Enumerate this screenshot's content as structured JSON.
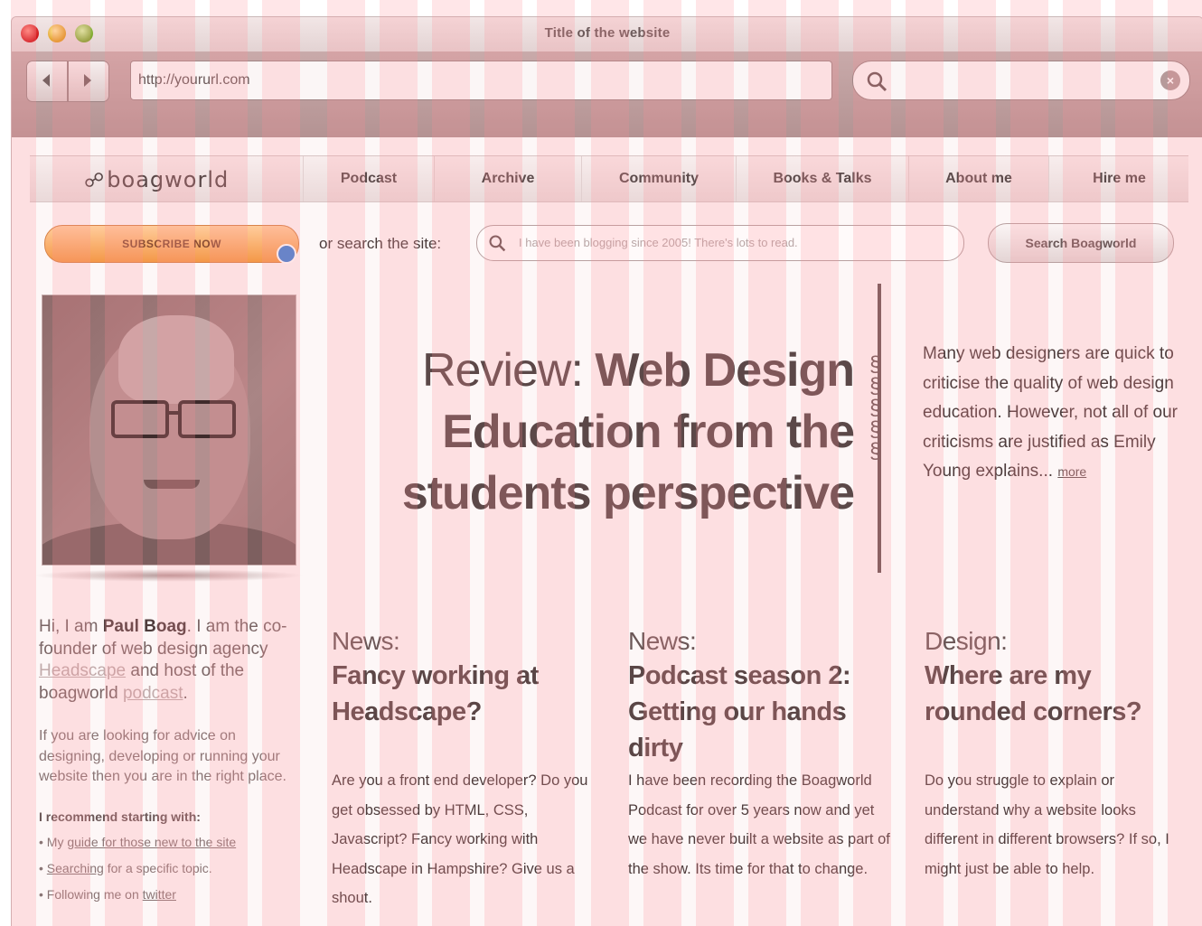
{
  "window": {
    "title": "Title of the website"
  },
  "toolbar": {
    "url": "http://yoururl.com"
  },
  "site": {
    "logo": "boagworld",
    "nav": [
      {
        "label": "Podcast"
      },
      {
        "label": "Archive"
      },
      {
        "label": "Community"
      },
      {
        "label": "Books & Talks"
      },
      {
        "label": "About me"
      },
      {
        "label": "Hire me"
      }
    ],
    "subscribe_label": "SUBSCRIBE NOW",
    "search_label": "or search the site:",
    "search_placeholder": "I have been blogging since 2005! There's lots to read.",
    "search_button": "Search Boagworld",
    "hero": {
      "light": "Review: ",
      "strong": "Web Design Education from the students perspective"
    },
    "intro": {
      "text": "Many web designers are quick to criticise the quality of web design education. However, not all of our criticisms are justified as Emily Young explains...",
      "more": "more"
    },
    "bio": {
      "p1_a": "Hi, I am ",
      "name": "Paul Boag",
      "p1_b": ". I am the co-founder of web design agency ",
      "agency_link": "Headscape",
      "p1_c": " and host of the boagworld ",
      "podcast_link": "podcast",
      "p1_d": ".",
      "p2": "If you are looking for advice on designing, developing or running your website then you are in the right place.",
      "recommend": "I recommend starting with:",
      "bullets": [
        {
          "pre": "My ",
          "link": "guide for those new to the site",
          "post": ""
        },
        {
          "pre": "",
          "link": "Searching",
          "post": " for a specific topic."
        },
        {
          "pre": "Following me on ",
          "link": "twitter",
          "post": ""
        }
      ]
    },
    "articles": [
      {
        "category": "News:",
        "title": "Fancy working at Headscape?",
        "body": "Are you a front end developer? Do you get obsessed by HTML, CSS, Javascript? Fancy working with Headscape in Hampshire? Give us a shout."
      },
      {
        "category": "News:",
        "title": "Podcast season 2: Getting our hands dirty",
        "body": "I have been recording the Boagworld Podcast for over 5 years now and yet we have never built a website as part of the show. Its time for that to change."
      },
      {
        "category": "Design:",
        "title": "Where are my rounded corners?",
        "body": "Do you struggle to explain or understand why a website looks different in different browsers? If so, I might just be able to help."
      }
    ]
  },
  "colors": {
    "grid_overlay": "#ff8c96",
    "subscribe": "#f49848",
    "text": "#5a4646"
  }
}
